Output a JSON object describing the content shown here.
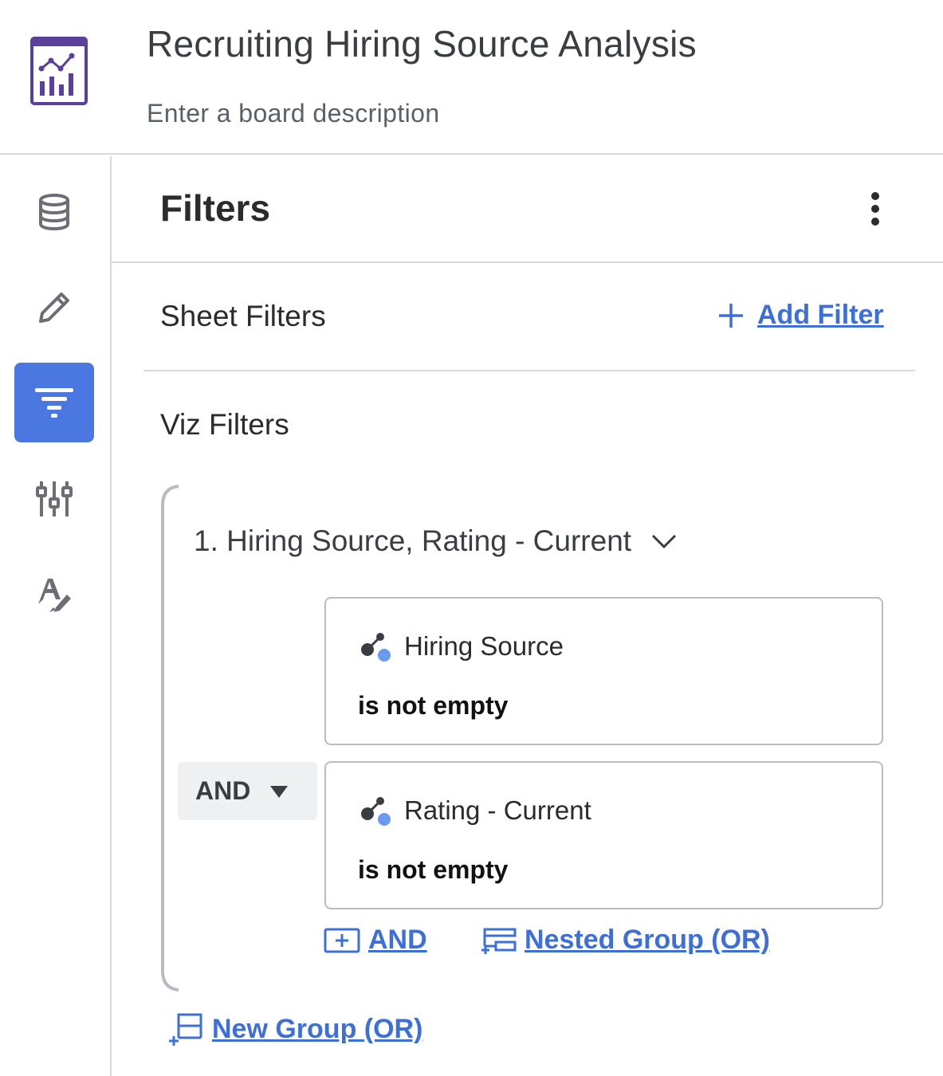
{
  "board": {
    "title": "Recruiting Hiring Source Analysis",
    "description_placeholder": "Enter a board description"
  },
  "sidebar": {
    "items": [
      {
        "icon": "database-icon",
        "active": false
      },
      {
        "icon": "pencil-icon",
        "active": false
      },
      {
        "icon": "filter-icon",
        "active": true
      },
      {
        "icon": "sliders-icon",
        "active": false
      },
      {
        "icon": "text-format-icon",
        "active": false
      }
    ]
  },
  "panel": {
    "title": "Filters",
    "sheet_filters_label": "Sheet Filters",
    "add_filter_label": "Add Filter",
    "viz_filters_label": "Viz Filters"
  },
  "group": {
    "label": "1. Hiring Source, Rating - Current",
    "operator": "AND",
    "conditions": [
      {
        "field": "Hiring Source",
        "operator": "is not empty"
      },
      {
        "field": "Rating - Current",
        "operator": "is not empty"
      }
    ],
    "add_and_label": "AND",
    "nested_group_label": "Nested Group (OR)"
  },
  "new_group_label": "New Group (OR)",
  "colors": {
    "accent": "#4a78e0",
    "link": "#3d6fd8",
    "logo": "#5b3f9a",
    "border": "#d6d8dc"
  }
}
